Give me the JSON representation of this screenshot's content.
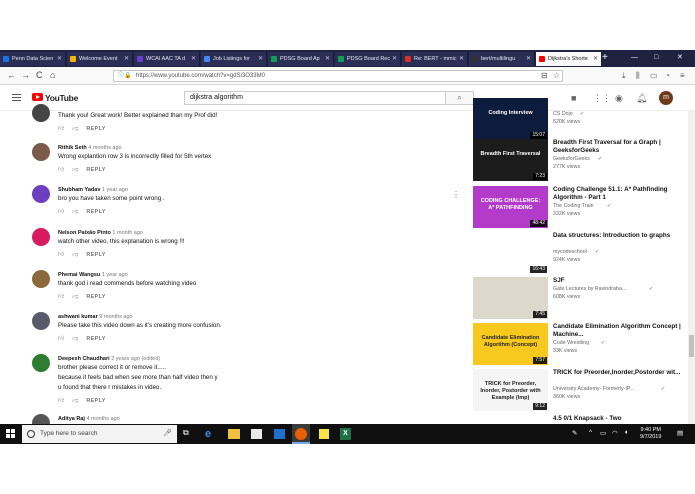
{
  "browser": {
    "tabs": [
      {
        "label": "Penn Data Scien",
        "color": "#1a73e8"
      },
      {
        "label": "Welcome Event",
        "color": "#f4b400"
      },
      {
        "label": "WCAI AAC TA d",
        "color": "#6a3fd0"
      },
      {
        "label": "Job Listings for",
        "color": "#4285f4"
      },
      {
        "label": "PDSG Board Ap",
        "color": "#0f9d58"
      },
      {
        "label": "PDSG Board Rec",
        "color": "#0f9d58"
      },
      {
        "label": "Re: BERT - mmic",
        "color": "#d93025"
      },
      {
        "label": "bert/multilingu",
        "color": "#333333"
      },
      {
        "label": "Dijkstra's Shorte",
        "color": "#ff0000"
      }
    ],
    "new_tab": "+",
    "window_controls": [
      "—",
      "□",
      "✕"
    ],
    "url": "https://www.youtube.com/watch?v=gdSi3O33M0",
    "nav": {
      "back": "←",
      "forward": "→",
      "reload": "C",
      "home": "⌂"
    }
  },
  "youtube": {
    "logo_text": "YouTube",
    "search_value": "dijkstra algorithm",
    "avatar_letter": "m"
  },
  "comments": [
    {
      "author": "",
      "time": "",
      "text": "Thank you! Great work! Better explained than my Prof did!",
      "reply": "REPLY",
      "avatar_color": "#444444"
    },
    {
      "author": "Rithik Seth",
      "time": "4 months ago",
      "text": "Wrong explantion row 3 is incorrectly filled for 5th vertex",
      "reply": "REPLY",
      "avatar_color": "#7a5a4a"
    },
    {
      "author": "Shubham Yadav",
      "time": "1 year ago",
      "text": "bro you have taken some point wrong .",
      "reply": "REPLY",
      "avatar_color": "#6b3fbf"
    },
    {
      "author": "Nelson Paixão Pinto",
      "time": "1 month ago",
      "text": "watch other video, this explanation is wrong !!!",
      "reply": "REPLY",
      "avatar_color": "#d81b60"
    },
    {
      "author": "Phemai Wangsu",
      "time": "1 year ago",
      "text": "thank god i read commends before watching video",
      "reply": "REPLY",
      "avatar_color": "#8a6a3a"
    },
    {
      "author": "ashwani kumar",
      "time": "9 months ago",
      "text": "Please take this video down as it's creating more confusion.",
      "reply": "REPLY",
      "avatar_color": "#5a5a6a"
    },
    {
      "author": "Deepesh Chaudhari",
      "time": "2 years ago (edited)",
      "lines": [
        "brother please correct it or remove it.....",
        "because it feels bad when see more than half video then y",
        "u found that there r mistakes in video."
      ],
      "reply": "REPLY",
      "avatar_color": "#2e7d32"
    },
    {
      "author": "Aditya Raj",
      "time": "4 months ago",
      "text": "",
      "reply": "",
      "avatar_color": "#555555"
    }
  ],
  "sidebar": [
    {
      "title": "",
      "channel": "CS Dojo",
      "views": "520K views",
      "duration": "15:07",
      "thumb_text": "Coding Interview",
      "thumb_bg": "#0d1b3d"
    },
    {
      "title": "Breadth First Traversal for a Graph | GeeksforGeeks",
      "channel": "GeeksforGeeks",
      "views": "277K views",
      "duration": "7:23",
      "thumb_text": "Breadth First Traversal",
      "thumb_bg": "#1c1c1c"
    },
    {
      "title": "Coding Challenge 51.1: A* Pathfinding Algorithm - Part 1",
      "channel": "The Coding Train",
      "views": "332K views",
      "duration": "48:42",
      "thumb_text": "CODING CHALLENGE: A* PATHFINDING",
      "thumb_bg": "#b23cc9"
    },
    {
      "title": "Data structures: Introduction to graphs",
      "channel": "mycodeschool",
      "views": "924K views",
      "duration": "16:43",
      "thumb_text": "",
      "thumb_bg": "#ffffff"
    },
    {
      "title": "SJF",
      "channel": "Gate Lectures by Ravindraba...",
      "views": "608K views",
      "duration": "7:45",
      "thumb_text": "",
      "thumb_bg": "#ddd8cc"
    },
    {
      "title": "Candidate Elimination Algorithm Concept | Machine...",
      "channel": "Code Wrestling",
      "views": "33K views",
      "duration": "7:57",
      "thumb_text": "Candidate Elimination Algorithm (Concept)",
      "thumb_bg": "#f7c81e"
    },
    {
      "title": "TRICK for Preorder,Inorder,Postorder wit...",
      "channel": "University Academy- Formerly-IP...",
      "views": "360K views",
      "duration": "9:12",
      "thumb_text": "TRICK for Preorder, Inorder, Postorder with Example (Imp)",
      "thumb_bg": "#f5f5f5"
    },
    {
      "title": "4.5 0/1 Knapsack - Two",
      "channel": "",
      "views": "",
      "duration": "",
      "thumb_text": "",
      "thumb_bg": "#ffffff"
    }
  ],
  "taskbar": {
    "search_placeholder": "Type here to search",
    "time": "9:40 PM",
    "date": "9/7/2019"
  }
}
